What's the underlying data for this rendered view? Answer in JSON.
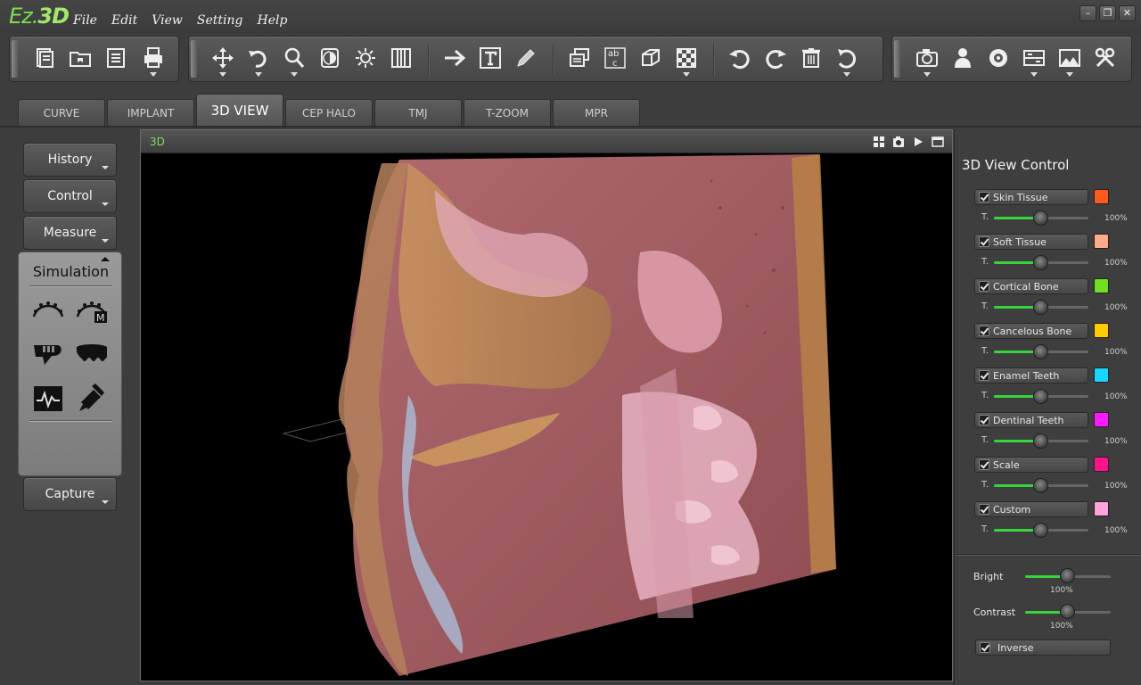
{
  "app": {
    "logo_part1": "Ez.",
    "logo_part2": "3D"
  },
  "menu": [
    "File",
    "Edit",
    "View",
    "Setting",
    "Help"
  ],
  "window_controls": [
    "minimize-icon",
    "restore-icon",
    "close-icon"
  ],
  "tabs": [
    {
      "label": "CURVE",
      "active": false
    },
    {
      "label": "IMPLANT",
      "active": false
    },
    {
      "label": "3D VIEW",
      "active": true
    },
    {
      "label": "CEP HALO",
      "active": false
    },
    {
      "label": "TMJ",
      "active": false
    },
    {
      "label": "T-ZOOM",
      "active": false
    },
    {
      "label": "MPR",
      "active": false
    }
  ],
  "left_panel": {
    "history": "History",
    "control": "Control",
    "measure": "Measure",
    "simulation": {
      "title": "Simulation",
      "icons": [
        "arch-curve-icon",
        "arch-curve-manual-icon",
        "jaw-simulation-icon",
        "teeth-row-icon",
        "airway-graph-icon",
        "implant-tool-icon"
      ]
    },
    "capture": "Capture"
  },
  "viewport": {
    "label": "3D",
    "icons": [
      "layout-grid-icon",
      "camera-icon",
      "play-icon",
      "maximize-icon"
    ]
  },
  "control_panel": {
    "title": "3D View Control",
    "t_label": "T.",
    "layers": [
      {
        "name": "Skin Tissue",
        "color": "#ff5a1e",
        "checked": true,
        "transparency": "100%",
        "value": 0.5
      },
      {
        "name": "Soft Tissue",
        "color": "#ffab8a",
        "checked": true,
        "transparency": "100%",
        "value": 0.5
      },
      {
        "name": "Cortical Bone",
        "color": "#6fe01e",
        "checked": true,
        "transparency": "100%",
        "value": 0.5
      },
      {
        "name": "Cancelous Bone",
        "color": "#ffcc00",
        "checked": true,
        "transparency": "100%",
        "value": 0.5
      },
      {
        "name": "Enamel Teeth",
        "color": "#19d6ff",
        "checked": true,
        "transparency": "100%",
        "value": 0.5
      },
      {
        "name": "Dentinal Teeth",
        "color": "#ff19ff",
        "checked": true,
        "transparency": "100%",
        "value": 0.5
      },
      {
        "name": "Scale",
        "color": "#ff128a",
        "checked": true,
        "transparency": "100%",
        "value": 0.5
      },
      {
        "name": "Custom",
        "color": "#ffa3dc",
        "checked": true,
        "transparency": "100%",
        "value": 0.5
      }
    ],
    "bright": {
      "label": "Bright",
      "value_text": "100%",
      "value": 0.5
    },
    "contrast": {
      "label": "Contrast",
      "value_text": "100%",
      "value": 0.5
    },
    "inverse": {
      "label": "Inverse",
      "checked": true
    }
  }
}
